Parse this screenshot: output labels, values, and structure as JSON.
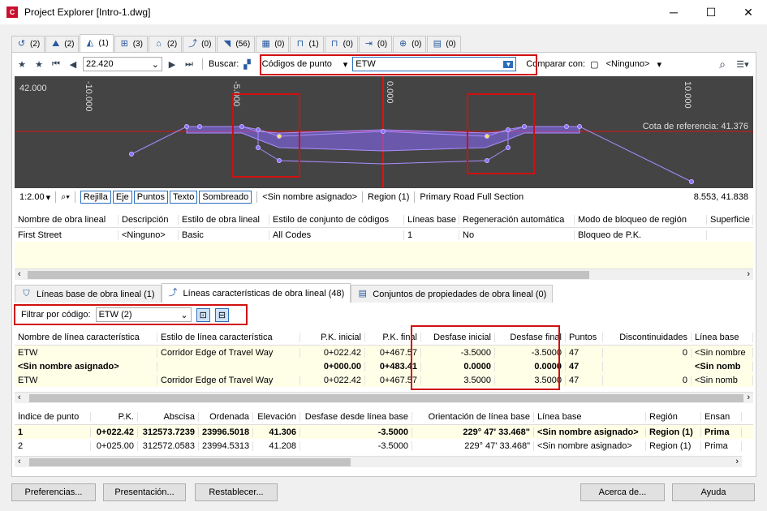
{
  "window": {
    "title": "Project Explorer [Intro-1.dwg]",
    "app_icon": "C",
    "min": "─",
    "max": "☐",
    "close": "✕"
  },
  "tabs": [
    {
      "icon": "curve-icon",
      "label": "(2)"
    },
    {
      "icon": "profile-icon",
      "label": "(2)"
    },
    {
      "icon": "corridor-icon",
      "label": "(1)"
    },
    {
      "icon": "section-icon",
      "label": "(3)"
    },
    {
      "icon": "surface-icon",
      "label": "(2)"
    },
    {
      "icon": "featureline-icon",
      "label": "(0)"
    },
    {
      "icon": "points-icon",
      "label": "(56)"
    },
    {
      "icon": "parcel-icon",
      "label": "(0)"
    },
    {
      "icon": "pipe-icon",
      "label": "(1)"
    },
    {
      "icon": "pressure-icon",
      "label": "(0)"
    },
    {
      "icon": "assembly-icon",
      "label": "(0)"
    },
    {
      "icon": "subassembly-icon",
      "label": "(0)"
    },
    {
      "icon": "sheet-icon",
      "label": "(0)"
    }
  ],
  "toolbar": {
    "station": "22.420",
    "search_label": "Buscar:",
    "search_type": "Códigos de punto",
    "search_value": "ETW",
    "compare_label": "Comparar con:",
    "compare_value": "<Ninguno>"
  },
  "view": {
    "elev": "42.000",
    "ticks": [
      "-10.000",
      "-5.000",
      "0.000",
      "10.000"
    ],
    "reference": "Cota de referencia: 41.376"
  },
  "status": {
    "scale": "1:2.00",
    "toggles": [
      "Rejilla",
      "Eje",
      "Puntos",
      "Texto",
      "Sombreado"
    ],
    "name": "<Sin nombre asignado>",
    "region": "Region (1)",
    "section": "Primary Road Full Section",
    "coords": "8.553, 41.838"
  },
  "grid1": {
    "headers": [
      "Nombre de obra lineal",
      "Descripción",
      "Estilo de obra lineal",
      "Estilo de conjunto de códigos",
      "Líneas base",
      "Regeneración automática",
      "Modo de bloqueo de región",
      "Superficie"
    ],
    "row": [
      "First Street",
      "<Ninguno>",
      "Basic",
      "All Codes",
      "1",
      "No",
      "Bloqueo de P.K.",
      ""
    ]
  },
  "btabs": [
    "Líneas base de obra lineal (1)",
    "Líneas características de obra lineal (48)",
    "Conjuntos de propiedades de obra lineal (0)"
  ],
  "filter": {
    "label": "Filtrar por código:",
    "value": "ETW  (2)"
  },
  "grid2": {
    "headers": [
      "Nombre de línea característica",
      "Estilo de línea característica",
      "P.K. inicial",
      "P.K. final",
      "Desfase inicial",
      "Desfase final",
      "Puntos",
      "Discontinuidades",
      "Línea base"
    ],
    "rows": [
      [
        "ETW",
        "Corridor Edge of Travel Way",
        "0+022.42",
        "0+467.57",
        "-3.5000",
        "-3.5000",
        "47",
        "0",
        "<Sin nombre"
      ],
      [
        "<Sin nombre asignado>",
        "",
        "0+000.00",
        "0+483.41",
        "0.0000",
        "0.0000",
        "47",
        "",
        "<Sin nomb"
      ],
      [
        "ETW",
        "Corridor Edge of Travel Way",
        "0+022.42",
        "0+467.57",
        "3.5000",
        "3.5000",
        "47",
        "0",
        "<Sin nomb"
      ]
    ]
  },
  "grid3": {
    "headers": [
      "Índice de punto",
      "P.K.",
      "Abscisa",
      "Ordenada",
      "Elevación",
      "Desfase desde línea base",
      "Orientación de línea base",
      "Línea base",
      "Región",
      "Ensan"
    ],
    "rows": [
      [
        "1",
        "0+022.42",
        "312573.7239",
        "23996.5018",
        "41.306",
        "-3.5000",
        "229° 47' 33.468\"",
        "<Sin nombre asignado>",
        "Region (1)",
        "Prima"
      ],
      [
        "2",
        "0+025.00",
        "312572.0583",
        "23994.5313",
        "41.208",
        "-3.5000",
        "229° 47' 33.468\"",
        "<Sin nombre asignado>",
        "Region (1)",
        "Prima"
      ]
    ]
  },
  "buttons": {
    "prefs": "Preferencias...",
    "present": "Presentación...",
    "reset": "Restablecer...",
    "about": "Acerca de...",
    "help": "Ayuda"
  },
  "colors": {
    "accent": "#2a6ebb",
    "red": "#d01010",
    "view_bg": "#444444",
    "corridor": "#8a6cff"
  }
}
